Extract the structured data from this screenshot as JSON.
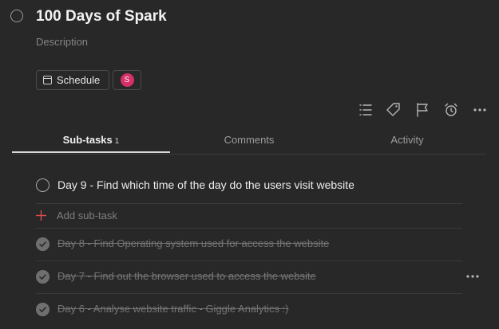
{
  "task": {
    "title": "100 Days of Spark",
    "description_placeholder": "Description"
  },
  "chips": {
    "schedule_label": "Schedule",
    "avatar_initial": "S"
  },
  "toolbar": {
    "icons": [
      "list-icon",
      "tag-icon",
      "flag-icon",
      "alarm-icon",
      "more-icon"
    ]
  },
  "tabs": {
    "subtasks_label": "Sub-tasks",
    "subtasks_count": "1",
    "comments_label": "Comments",
    "activity_label": "Activity"
  },
  "subtasks": {
    "open": [
      {
        "label": "Day 9 - Find which time of the day do the users visit website"
      }
    ],
    "add_label": "Add sub-task",
    "completed": [
      {
        "label": "Day 8 - Find Operating system used for access the website"
      },
      {
        "label": "Day 7 - Find out the browser used to access the website"
      },
      {
        "label": "Day 6 - Analyse website traffic - Giggle Analytics :)"
      }
    ]
  },
  "colors": {
    "background": "#282828",
    "avatar": "#d62f6a",
    "add_plus": "#de4c4a",
    "completed_check": "#6f6f6f"
  }
}
